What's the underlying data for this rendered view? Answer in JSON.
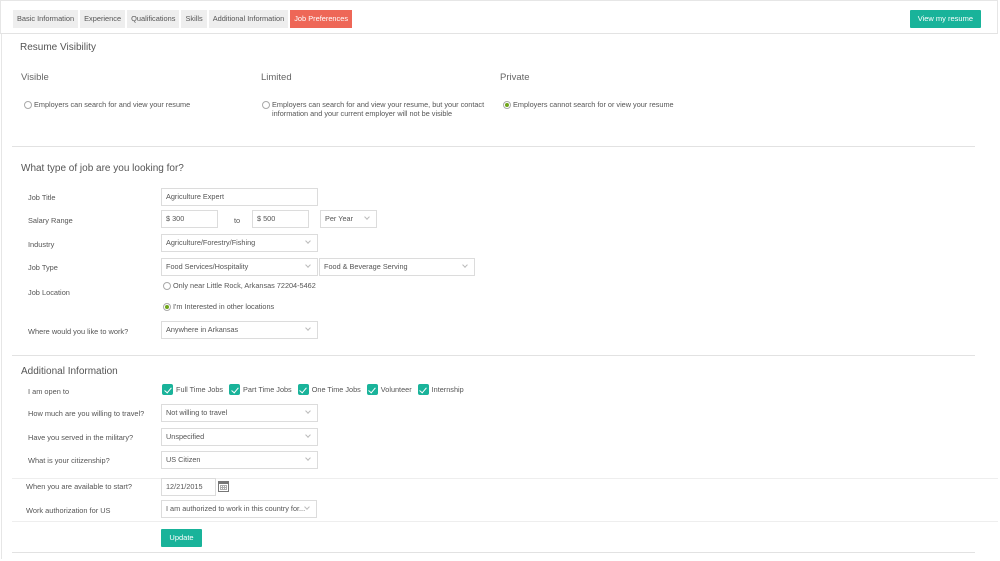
{
  "tabs": [
    {
      "label": "Basic Information"
    },
    {
      "label": "Experience"
    },
    {
      "label": "Qualifications"
    },
    {
      "label": "Skills"
    },
    {
      "label": "Additional Information"
    },
    {
      "label": "Job Preferences",
      "active": true
    }
  ],
  "header": {
    "view_resume_label": "View my resume"
  },
  "visibility": {
    "title": "Resume Visibility",
    "options": [
      {
        "heading": "Visible",
        "text": "Employers can search for and view your resume",
        "selected": false
      },
      {
        "heading": "Limited",
        "text_line1": "Employers can search for and view your resume, but your contact",
        "text_line2": "information and your current employer will not be visible",
        "selected": false
      },
      {
        "heading": "Private",
        "text": "Employers cannot search for or view your resume",
        "selected": true
      }
    ]
  },
  "job": {
    "title": "What type of job are you looking for?",
    "job_title_label": "Job Title",
    "job_title_value": "Agriculture Expert",
    "salary_label": "Salary Range",
    "salary_min": "$ 300",
    "salary_to": "to",
    "salary_max": "$ 500",
    "salary_period": "Per Year",
    "industry_label": "Industry",
    "industry_value": "Agriculture/Forestry/Fishing",
    "job_type_label": "Job Type",
    "job_type_value": "Food Services/Hospitality",
    "job_subtype_value": "Food & Beverage Serving",
    "location_label": "Job Location",
    "location_option1": "Only near Little Rock, Arkansas 72204-5462",
    "location_option2": "I'm Interested in other locations",
    "where_label": "Where would you like to work?",
    "where_value": "Anywhere in Arkansas"
  },
  "additional": {
    "title": "Additional Information",
    "open_to_label": "I am open to",
    "open_to": [
      "Full Time Jobs",
      "Part Time Jobs",
      "One Time Jobs",
      "Volunteer",
      "Internship"
    ],
    "travel_label": "How much are you willing to travel?",
    "travel_value": "Not willing to travel",
    "military_label": "Have you served in the military?",
    "military_value": "Unspecified",
    "citizenship_label": "What is your citizenship?",
    "citizenship_value": "US Citizen",
    "start_label": "When you are available to start?",
    "start_value": "12/21/2015",
    "auth_label": "Work authorization for US",
    "auth_value": "I am authorized to work in this country for...",
    "update_label": "Update"
  },
  "colors": {
    "accent": "#19b39a",
    "active_tab": "#ee6757",
    "radio_on": "#6fa51b"
  }
}
